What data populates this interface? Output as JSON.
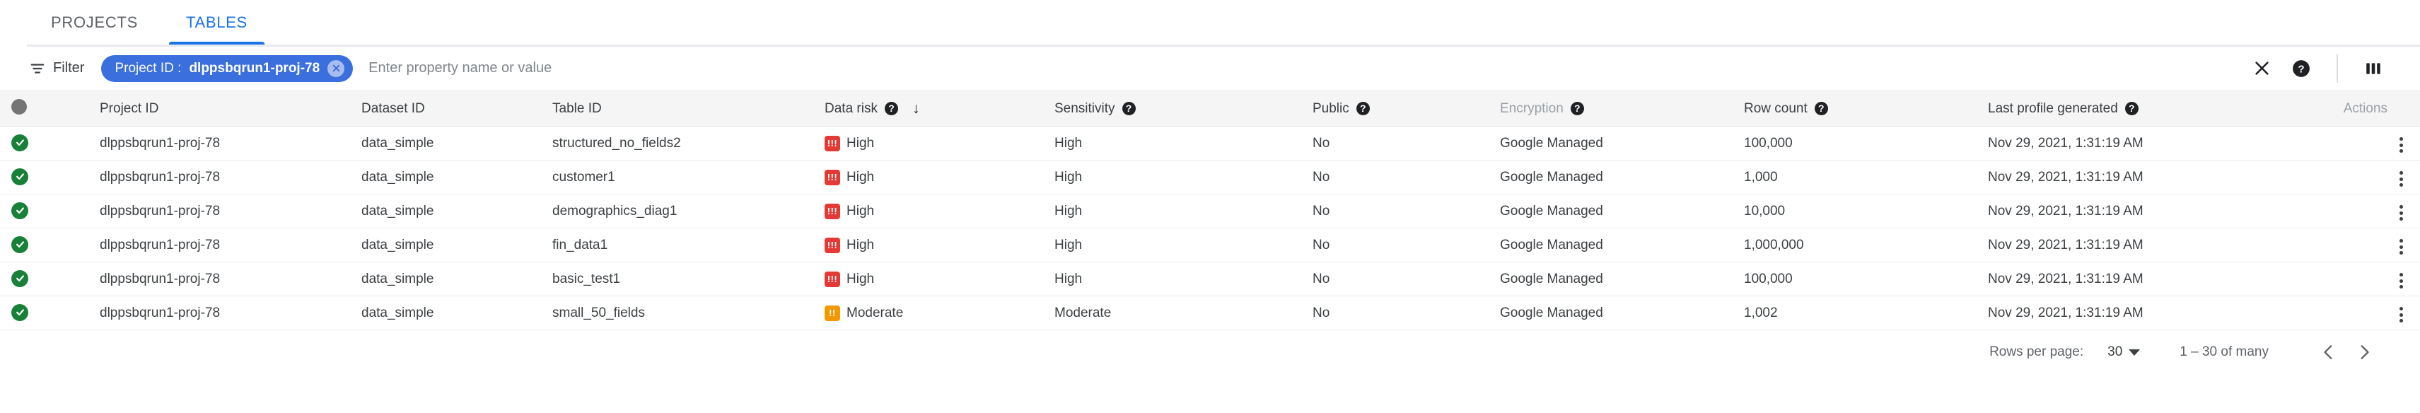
{
  "tabs": [
    {
      "label": "PROJECTS",
      "active": false
    },
    {
      "label": "TABLES",
      "active": true
    }
  ],
  "toolbar": {
    "filter_label": "Filter",
    "chip": {
      "key": "Project ID :",
      "value": "dlppsbqrun1-proj-78"
    },
    "input_placeholder": "Enter property name or value",
    "input_value": "",
    "close_icon": "close-icon",
    "help_icon": "help-icon",
    "columns_icon": "column-display-icon"
  },
  "table": {
    "columns": [
      {
        "key": "select",
        "label": "",
        "help": false
      },
      {
        "key": "project_id",
        "label": "Project ID",
        "help": false
      },
      {
        "key": "dataset_id",
        "label": "Dataset ID",
        "help": false
      },
      {
        "key": "table_id",
        "label": "Table ID",
        "help": false
      },
      {
        "key": "data_risk",
        "label": "Data risk",
        "help": true,
        "sorted": "desc"
      },
      {
        "key": "sensitivity",
        "label": "Sensitivity",
        "help": true
      },
      {
        "key": "public",
        "label": "Public",
        "help": true
      },
      {
        "key": "encryption",
        "label": "Encryption",
        "help": true,
        "muted": true
      },
      {
        "key": "row_count",
        "label": "Row count",
        "help": true
      },
      {
        "key": "last_profile",
        "label": "Last profile generated",
        "help": true
      },
      {
        "key": "actions",
        "label": "Actions",
        "help": false,
        "muted": true
      }
    ],
    "sort_arrow": "↓",
    "rows": [
      {
        "status": "ok",
        "project_id": "dlppsbqrun1-proj-78",
        "dataset_id": "data_simple",
        "table_id": "structured_no_fields2",
        "data_risk": "High",
        "data_risk_level": "high",
        "sensitivity": "High",
        "public": "No",
        "encryption": "Google Managed",
        "row_count": "100,000",
        "last_profile": "Nov 29, 2021, 1:31:19 AM"
      },
      {
        "status": "ok",
        "project_id": "dlppsbqrun1-proj-78",
        "dataset_id": "data_simple",
        "table_id": "customer1",
        "data_risk": "High",
        "data_risk_level": "high",
        "sensitivity": "High",
        "public": "No",
        "encryption": "Google Managed",
        "row_count": "1,000",
        "last_profile": "Nov 29, 2021, 1:31:19 AM"
      },
      {
        "status": "ok",
        "project_id": "dlppsbqrun1-proj-78",
        "dataset_id": "data_simple",
        "table_id": "demographics_diag1",
        "data_risk": "High",
        "data_risk_level": "high",
        "sensitivity": "High",
        "public": "No",
        "encryption": "Google Managed",
        "row_count": "10,000",
        "last_profile": "Nov 29, 2021, 1:31:19 AM"
      },
      {
        "status": "ok",
        "project_id": "dlppsbqrun1-proj-78",
        "dataset_id": "data_simple",
        "table_id": "fin_data1",
        "data_risk": "High",
        "data_risk_level": "high",
        "sensitivity": "High",
        "public": "No",
        "encryption": "Google Managed",
        "row_count": "1,000,000",
        "last_profile": "Nov 29, 2021, 1:31:19 AM"
      },
      {
        "status": "ok",
        "project_id": "dlppsbqrun1-proj-78",
        "dataset_id": "data_simple",
        "table_id": "basic_test1",
        "data_risk": "High",
        "data_risk_level": "high",
        "sensitivity": "High",
        "public": "No",
        "encryption": "Google Managed",
        "row_count": "100,000",
        "last_profile": "Nov 29, 2021, 1:31:19 AM"
      },
      {
        "status": "ok",
        "project_id": "dlppsbqrun1-proj-78",
        "dataset_id": "data_simple",
        "table_id": "small_50_fields",
        "data_risk": "Moderate",
        "data_risk_level": "moderate",
        "sensitivity": "Moderate",
        "public": "No",
        "encryption": "Google Managed",
        "row_count": "1,002",
        "last_profile": "Nov 29, 2021, 1:31:19 AM"
      }
    ]
  },
  "pagination": {
    "rows_per_page_label": "Rows per page:",
    "rows_per_page_value": "30",
    "range_label": "1 – 30 of many",
    "prev_icon": "chevron-left-icon",
    "next_icon": "chevron-right-icon"
  },
  "colors": {
    "accent": "#1a73e8",
    "chip": "#3b6fdd",
    "risk_high": "#e53935",
    "risk_moderate": "#f29900",
    "status_ok": "#188038"
  }
}
